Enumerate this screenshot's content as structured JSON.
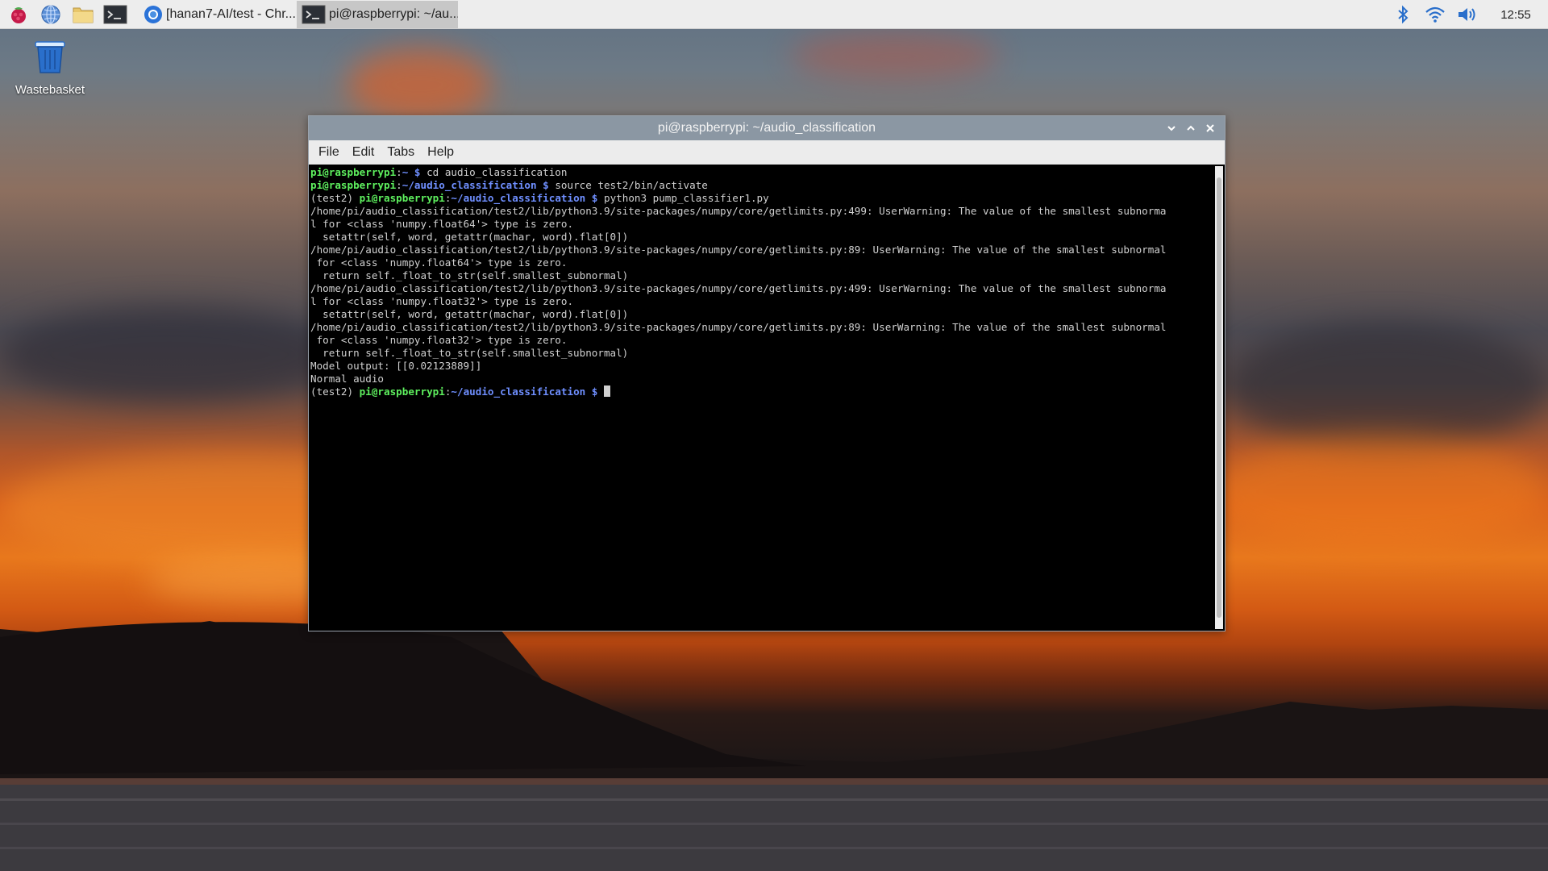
{
  "taskbar": {
    "launchers": [
      {
        "icon": "raspberry-menu-icon"
      },
      {
        "icon": "web-browser-icon"
      },
      {
        "icon": "file-manager-icon"
      },
      {
        "icon": "terminal-icon"
      }
    ],
    "tasks": [
      {
        "label": "[hanan7-AI/test - Chr...",
        "icon": "chromium-icon"
      },
      {
        "label": "pi@raspberrypi: ~/au...",
        "icon": "terminal-icon"
      }
    ],
    "tray": {
      "icons": [
        "bluetooth-icon",
        "wifi-icon",
        "volume-icon"
      ],
      "clock": "12:55"
    }
  },
  "desktop": {
    "icons": [
      {
        "label": "Wastebasket",
        "icon": "trash-icon"
      }
    ]
  },
  "terminal": {
    "title": "pi@raspberrypi: ~/audio_classification",
    "menu": [
      "File",
      "Edit",
      "Tabs",
      "Help"
    ],
    "lines": [
      {
        "parts": [
          {
            "t": "pi@raspberrypi",
            "c": "g"
          },
          {
            "t": ":",
            "c": ""
          },
          {
            "t": "~ $",
            "c": "b"
          },
          {
            "t": " cd audio_classification",
            "c": ""
          }
        ]
      },
      {
        "parts": [
          {
            "t": "pi@raspberrypi",
            "c": "g"
          },
          {
            "t": ":",
            "c": ""
          },
          {
            "t": "~/audio_classification $",
            "c": "b"
          },
          {
            "t": " source test2/bin/activate",
            "c": ""
          }
        ]
      },
      {
        "parts": [
          {
            "t": "(test2) ",
            "c": ""
          },
          {
            "t": "pi@raspberrypi",
            "c": "g"
          },
          {
            "t": ":",
            "c": ""
          },
          {
            "t": "~/audio_classification $",
            "c": "b"
          },
          {
            "t": " python3 pump_classifier1.py",
            "c": ""
          }
        ]
      },
      {
        "parts": [
          {
            "t": "/home/pi/audio_classification/test2/lib/python3.9/site-packages/numpy/core/getlimits.py:499: UserWarning: The value of the smallest subnorma",
            "c": ""
          }
        ]
      },
      {
        "parts": [
          {
            "t": "l for <class 'numpy.float64'> type is zero.",
            "c": ""
          }
        ]
      },
      {
        "parts": [
          {
            "t": "  setattr(self, word, getattr(machar, word).flat[0])",
            "c": ""
          }
        ]
      },
      {
        "parts": [
          {
            "t": "/home/pi/audio_classification/test2/lib/python3.9/site-packages/numpy/core/getlimits.py:89: UserWarning: The value of the smallest subnormal",
            "c": ""
          }
        ]
      },
      {
        "parts": [
          {
            "t": " for <class 'numpy.float64'> type is zero.",
            "c": ""
          }
        ]
      },
      {
        "parts": [
          {
            "t": "  return self._float_to_str(self.smallest_subnormal)",
            "c": ""
          }
        ]
      },
      {
        "parts": [
          {
            "t": "/home/pi/audio_classification/test2/lib/python3.9/site-packages/numpy/core/getlimits.py:499: UserWarning: The value of the smallest subnorma",
            "c": ""
          }
        ]
      },
      {
        "parts": [
          {
            "t": "l for <class 'numpy.float32'> type is zero.",
            "c": ""
          }
        ]
      },
      {
        "parts": [
          {
            "t": "  setattr(self, word, getattr(machar, word).flat[0])",
            "c": ""
          }
        ]
      },
      {
        "parts": [
          {
            "t": "/home/pi/audio_classification/test2/lib/python3.9/site-packages/numpy/core/getlimits.py:89: UserWarning: The value of the smallest subnormal",
            "c": ""
          }
        ]
      },
      {
        "parts": [
          {
            "t": " for <class 'numpy.float32'> type is zero.",
            "c": ""
          }
        ]
      },
      {
        "parts": [
          {
            "t": "  return self._float_to_str(self.smallest_subnormal)",
            "c": ""
          }
        ]
      },
      {
        "parts": [
          {
            "t": "Model output: [[0.02123889]]",
            "c": ""
          }
        ]
      },
      {
        "parts": [
          {
            "t": "Normal audio",
            "c": ""
          }
        ]
      },
      {
        "parts": [
          {
            "t": "(test2) ",
            "c": ""
          },
          {
            "t": "pi@raspberrypi",
            "c": "g"
          },
          {
            "t": ":",
            "c": ""
          },
          {
            "t": "~/audio_classification $",
            "c": "b"
          },
          {
            "t": " ",
            "c": ""
          }
        ],
        "cursor": true
      }
    ]
  },
  "colors": {
    "prompt_user": "#5ef05e",
    "prompt_path": "#6f8fff",
    "terminal_bg": "#000000",
    "titlebar": "#8b97a3"
  }
}
